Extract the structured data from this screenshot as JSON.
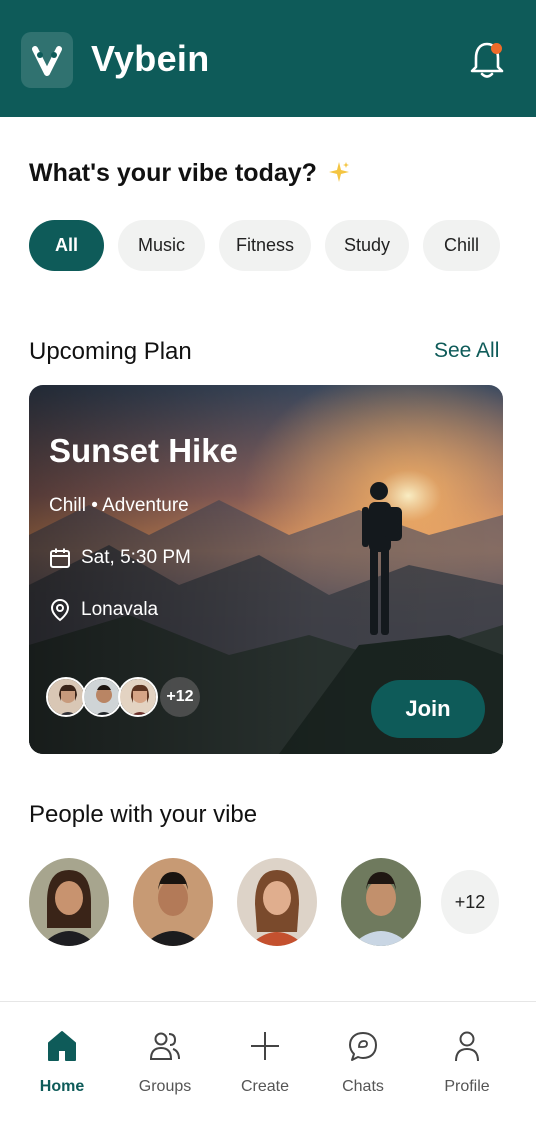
{
  "header": {
    "app_title": "Vybein",
    "brand_color": "#0e5b59",
    "notification_dot_color": "#ef6b2a"
  },
  "vibe": {
    "heading": "What's your vibe today?",
    "sparkle_icon": "sparkle-icon",
    "chips": [
      {
        "label": "All",
        "active": true
      },
      {
        "label": "Music",
        "active": false
      },
      {
        "label": "Fitness",
        "active": false
      },
      {
        "label": "Study",
        "active": false
      },
      {
        "label": "Chill",
        "active": false
      }
    ]
  },
  "upcoming": {
    "title": "Upcoming Plan",
    "see_all_label": "See All",
    "plan": {
      "name": "Sunset Hike",
      "tags": "Chill • Adventure",
      "datetime": "Sat, 5:30 PM",
      "location": "Lonavala",
      "attendees_more": "+12",
      "join_label": "Join"
    }
  },
  "people": {
    "title": "People with your vibe",
    "more_count": "+12"
  },
  "nav": {
    "items": [
      {
        "label": "Home",
        "icon": "home-icon",
        "active": true
      },
      {
        "label": "Groups",
        "icon": "groups-icon",
        "active": false
      },
      {
        "label": "Create",
        "icon": "plus-icon",
        "active": false
      },
      {
        "label": "Chats",
        "icon": "chat-icon",
        "active": false
      },
      {
        "label": "Profile",
        "icon": "profile-icon",
        "active": false
      }
    ]
  }
}
